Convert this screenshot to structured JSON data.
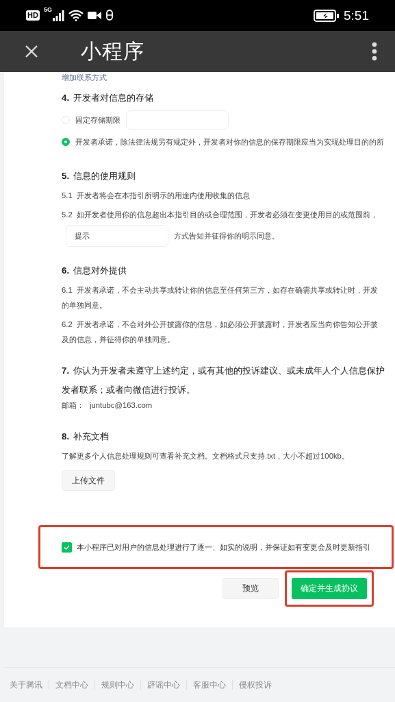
{
  "status_bar": {
    "hd": "HD",
    "network": "5G",
    "time": "5:51"
  },
  "app_bar": {
    "title": "小程序"
  },
  "partial_link": "增加联系方式",
  "sections": [
    {
      "number": "4.",
      "title": [
        "开发者对信息的存储"
      ],
      "blocks": [
        {
          "kind": "radio",
          "label": "固定存储期限",
          "selected": false,
          "field": true
        },
        {
          "kind": "radio",
          "label": "开发者承诺，除法律法规另有规定外，开发者对你的信息的保存期限应当为实现处理目的的所",
          "selected": true
        }
      ]
    },
    {
      "number": "5.",
      "title": [
        "信息的使用规则"
      ],
      "blocks": [
        {
          "kind": "clause",
          "number": "5.1",
          "lines": [
            "开发者将会在本指引所明示的用途内使用收集的信息"
          ]
        },
        {
          "kind": "clause",
          "number": "5.2",
          "lines": [
            "如开发者使用你的信息超出本指引目的或合理范围，开发者必须在变更使用目的或范围前，"
          ]
        },
        {
          "kind": "field_line",
          "value": "提示",
          "text": "方式告知并征得你的明示同意。"
        }
      ]
    },
    {
      "number": "6.",
      "title": [
        "信息对外提供"
      ],
      "blocks": [
        {
          "kind": "clause",
          "number": "6.1",
          "lines": [
            "开发者承诺，不会主动共享或转让你的信息至任何第三方，如存在确需共享或转让时，开发",
            "的单独同意。"
          ]
        },
        {
          "kind": "clause",
          "number": "6.2",
          "lines": [
            "开发者承诺，不会对外公开披露你的信息，如必须公开披露时，开发者应当向你告知公开披",
            "及的信息，并征得你的单独同意。"
          ]
        }
      ]
    },
    {
      "number": "7.",
      "title": [
        "你认为开发者未遵守上述约定，或有其他的投诉建议、或未成年人个人信息保护",
        "发者联系；或者向微信进行投诉。"
      ],
      "blocks": [
        {
          "kind": "email",
          "label": "邮箱：",
          "value": "juntubc@163.com"
        }
      ]
    },
    {
      "number": "8.",
      "title": [
        "补充文档"
      ],
      "blocks": [
        {
          "kind": "note",
          "text": "了解更多个人信息处理规则可查看补充文档。文档格式只支持.txt，大小不超过100kb。"
        },
        {
          "kind": "upload",
          "label": "上传文件"
        }
      ]
    }
  ],
  "agreement": {
    "checked": true,
    "text": "本小程序已对用户的信息处理进行了逐一、如实的说明，并保证如有变更会及时更新指引"
  },
  "buttons": [
    {
      "kind": "secondary",
      "label": "预览"
    },
    {
      "kind": "primary",
      "label": "确定并生成协议"
    }
  ],
  "footer_links": [
    "关于腾讯",
    "文档中心",
    "规则中心",
    "辟谣中心",
    "客服中心",
    "侵权投诉"
  ]
}
